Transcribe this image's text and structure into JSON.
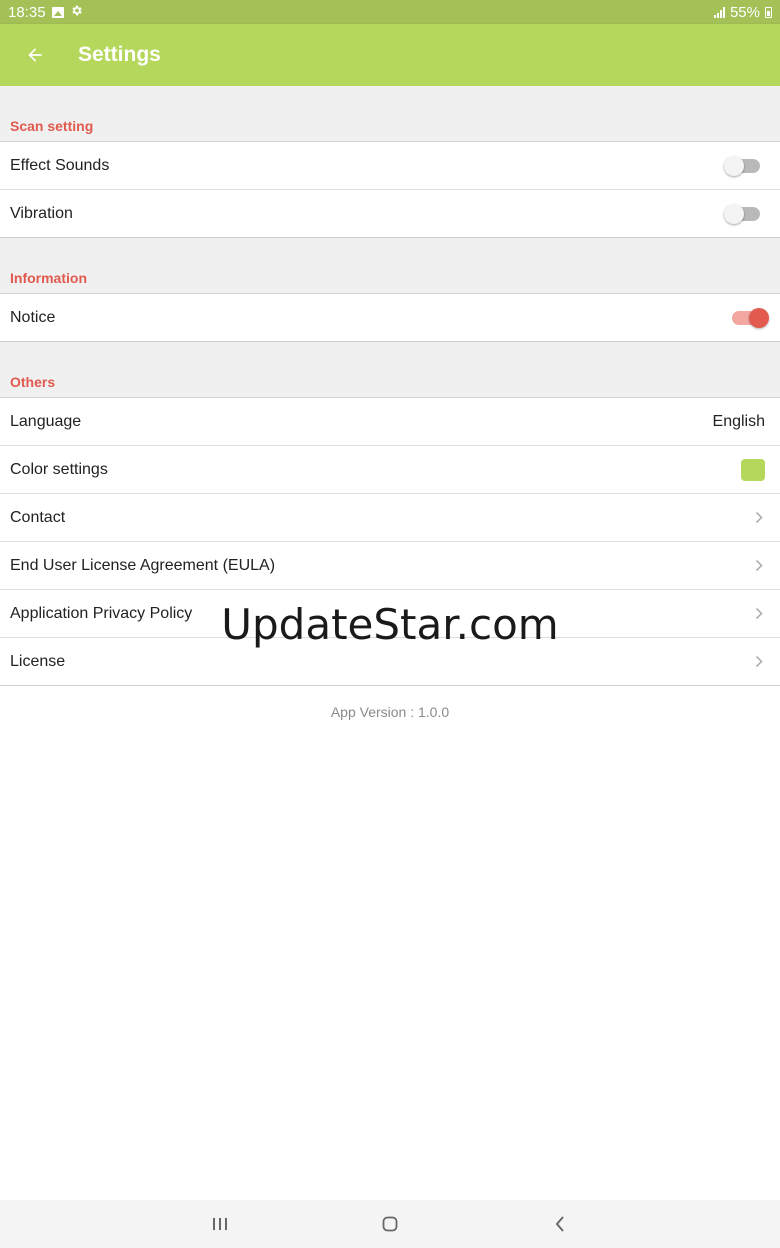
{
  "status_bar": {
    "time": "18:35",
    "battery": "55%",
    "icons": [
      "image-icon",
      "gear-icon",
      "signal-icon",
      "battery-icon"
    ]
  },
  "app_bar": {
    "title": "Settings",
    "back_icon": "arrow-left-icon",
    "color": "#b5d75c"
  },
  "sections": {
    "scan": {
      "title": "Scan setting",
      "effect_sounds": {
        "label": "Effect Sounds",
        "on": false
      },
      "vibration": {
        "label": "Vibration",
        "on": false
      }
    },
    "information": {
      "title": "Information",
      "notice": {
        "label": "Notice",
        "on": true
      }
    },
    "others": {
      "title": "Others",
      "language": {
        "label": "Language",
        "value": "English"
      },
      "color_settings": {
        "label": "Color settings",
        "color": "#b5d75c"
      },
      "contact": {
        "label": "Contact"
      },
      "eula": {
        "label": "End User License Agreement (EULA)"
      },
      "privacy": {
        "label": "Application Privacy Policy"
      },
      "license": {
        "label": "License"
      }
    }
  },
  "app_version": "App Version : 1.0.0",
  "watermark": "UpdateStar.com",
  "accent_color": "#e05a4e",
  "nav_bar": {
    "icons": [
      "recent-apps-icon",
      "home-icon",
      "back-icon"
    ]
  }
}
